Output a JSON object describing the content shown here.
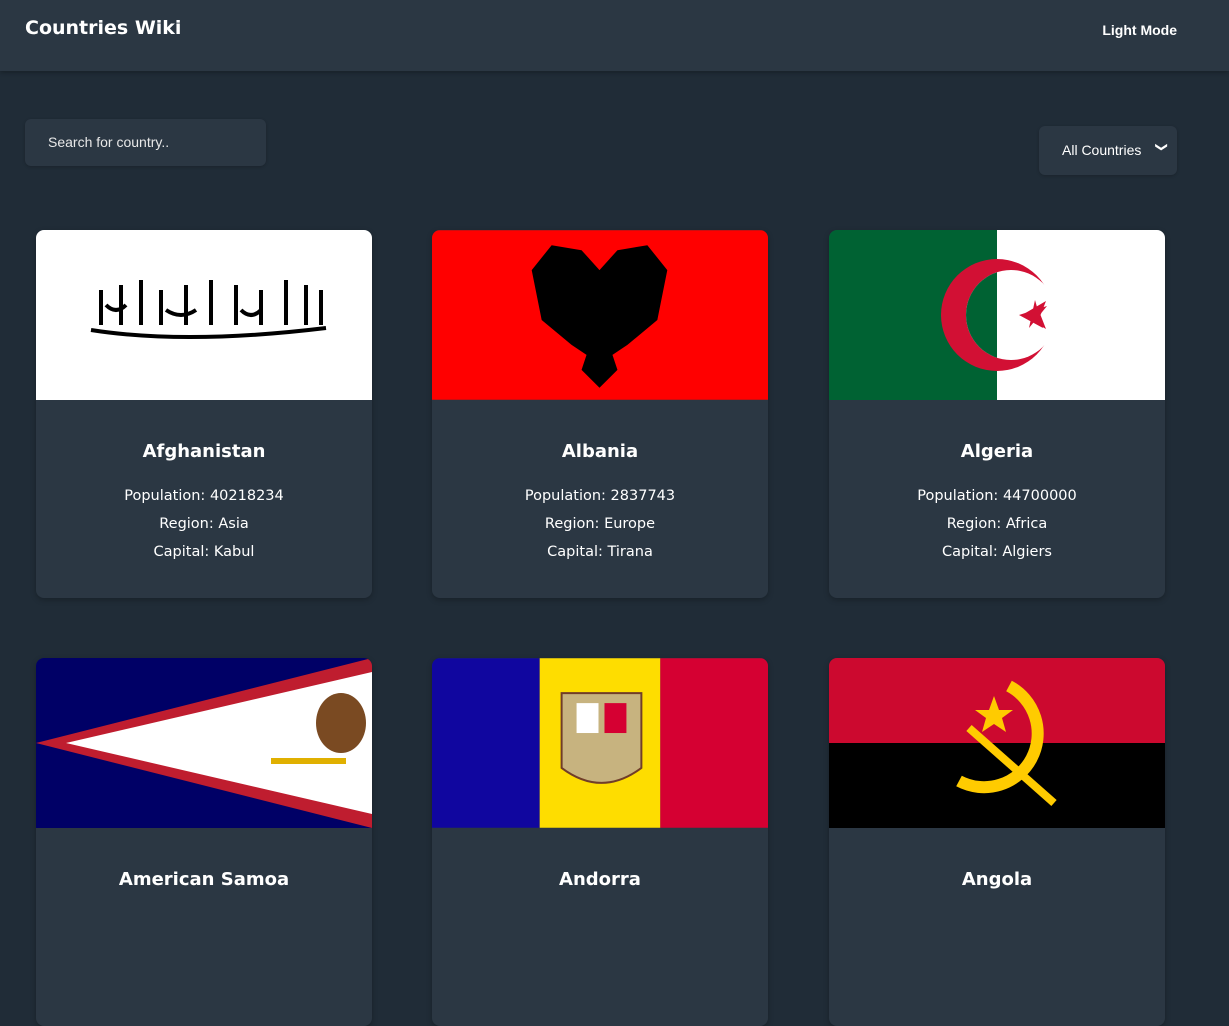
{
  "header": {
    "title": "Countries Wiki",
    "mode_toggle": "Light Mode"
  },
  "search": {
    "placeholder": "Search for country.."
  },
  "filter": {
    "selected": "All Countries"
  },
  "labels": {
    "population": "Population: ",
    "region": "Region: ",
    "capital": "Capital: "
  },
  "countries": [
    {
      "name": "Afghanistan",
      "population": "40218234",
      "region": "Asia",
      "capital": "Kabul",
      "flag": "flag-afghanistan"
    },
    {
      "name": "Albania",
      "population": "2837743",
      "region": "Europe",
      "capital": "Tirana",
      "flag": "flag-albania"
    },
    {
      "name": "Algeria",
      "population": "44700000",
      "region": "Africa",
      "capital": "Algiers",
      "flag": "flag-algeria"
    },
    {
      "name": "American Samoa",
      "flag": "flag-american-samoa"
    },
    {
      "name": "Andorra",
      "flag": "flag-andorra"
    },
    {
      "name": "Angola",
      "flag": "flag-angola"
    }
  ]
}
